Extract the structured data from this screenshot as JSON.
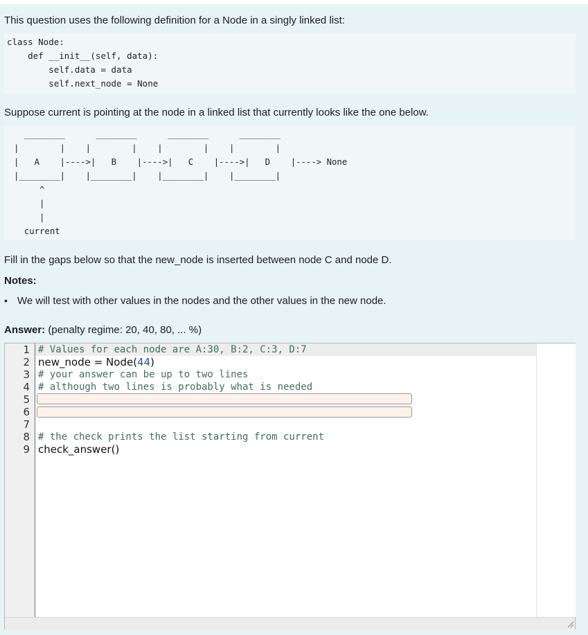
{
  "question": {
    "intro": "This question uses the following definition for a Node in a singly linked list:",
    "class_code": "class Node:\n    def __init__(self, data):\n        self.data = data\n        self.next_node = None",
    "suppose": "Suppose current is pointing at the node in a linked list that currently looks like the one below.",
    "diagram": "  ________      ________      ________      ________\n|        |    |        |    |        |    |        |\n|   A    |---->|   B    |---->|   C    |---->|   D    |----> None\n|________|    |________|    |________|    |________|\n     ^\n     |\n     |\n  current",
    "fill_in": "Fill in the gaps below so that the new_node is inserted between node C and node D.",
    "notes_heading": "Notes:",
    "notes": [
      "We will test with other values in the nodes and the other values in the new node."
    ],
    "answer_label": "Answer:",
    "penalty": "(penalty regime: 20, 40, 80, ... %)"
  },
  "editor": {
    "line_numbers": [
      "1",
      "2",
      "3",
      "4",
      "5",
      "6",
      "7",
      "8",
      "9"
    ],
    "line1": "# Values for each node are A:30, B:2, C:3, D:7",
    "line2_text": "new_node = Node(",
    "line2_num": "44",
    "line2_close": ")",
    "line3": "# your answer can be up to two lines",
    "line4": "# although two lines is probably what is needed",
    "gap1_value": "",
    "gap2_value": "",
    "line8": "# the check prints the list starting from current",
    "line9": "check_answer()"
  }
}
